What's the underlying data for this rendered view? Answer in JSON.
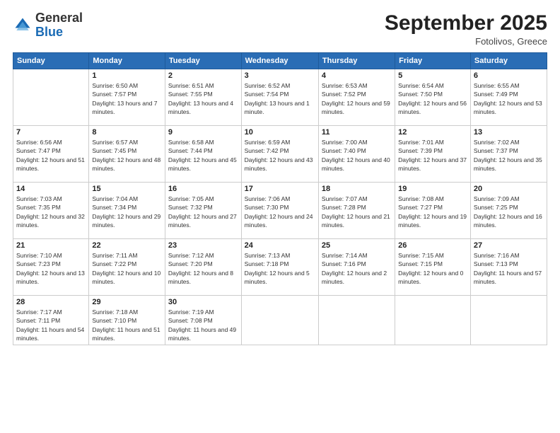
{
  "header": {
    "logo_general": "General",
    "logo_blue": "Blue",
    "month_title": "September 2025",
    "subtitle": "Fotolivos, Greece"
  },
  "days_of_week": [
    "Sunday",
    "Monday",
    "Tuesday",
    "Wednesday",
    "Thursday",
    "Friday",
    "Saturday"
  ],
  "weeks": [
    [
      {
        "day": "",
        "sunrise": "",
        "sunset": "",
        "daylight": ""
      },
      {
        "day": "1",
        "sunrise": "Sunrise: 6:50 AM",
        "sunset": "Sunset: 7:57 PM",
        "daylight": "Daylight: 13 hours and 7 minutes."
      },
      {
        "day": "2",
        "sunrise": "Sunrise: 6:51 AM",
        "sunset": "Sunset: 7:55 PM",
        "daylight": "Daylight: 13 hours and 4 minutes."
      },
      {
        "day": "3",
        "sunrise": "Sunrise: 6:52 AM",
        "sunset": "Sunset: 7:54 PM",
        "daylight": "Daylight: 13 hours and 1 minute."
      },
      {
        "day": "4",
        "sunrise": "Sunrise: 6:53 AM",
        "sunset": "Sunset: 7:52 PM",
        "daylight": "Daylight: 12 hours and 59 minutes."
      },
      {
        "day": "5",
        "sunrise": "Sunrise: 6:54 AM",
        "sunset": "Sunset: 7:50 PM",
        "daylight": "Daylight: 12 hours and 56 minutes."
      },
      {
        "day": "6",
        "sunrise": "Sunrise: 6:55 AM",
        "sunset": "Sunset: 7:49 PM",
        "daylight": "Daylight: 12 hours and 53 minutes."
      }
    ],
    [
      {
        "day": "7",
        "sunrise": "Sunrise: 6:56 AM",
        "sunset": "Sunset: 7:47 PM",
        "daylight": "Daylight: 12 hours and 51 minutes."
      },
      {
        "day": "8",
        "sunrise": "Sunrise: 6:57 AM",
        "sunset": "Sunset: 7:45 PM",
        "daylight": "Daylight: 12 hours and 48 minutes."
      },
      {
        "day": "9",
        "sunrise": "Sunrise: 6:58 AM",
        "sunset": "Sunset: 7:44 PM",
        "daylight": "Daylight: 12 hours and 45 minutes."
      },
      {
        "day": "10",
        "sunrise": "Sunrise: 6:59 AM",
        "sunset": "Sunset: 7:42 PM",
        "daylight": "Daylight: 12 hours and 43 minutes."
      },
      {
        "day": "11",
        "sunrise": "Sunrise: 7:00 AM",
        "sunset": "Sunset: 7:40 PM",
        "daylight": "Daylight: 12 hours and 40 minutes."
      },
      {
        "day": "12",
        "sunrise": "Sunrise: 7:01 AM",
        "sunset": "Sunset: 7:39 PM",
        "daylight": "Daylight: 12 hours and 37 minutes."
      },
      {
        "day": "13",
        "sunrise": "Sunrise: 7:02 AM",
        "sunset": "Sunset: 7:37 PM",
        "daylight": "Daylight: 12 hours and 35 minutes."
      }
    ],
    [
      {
        "day": "14",
        "sunrise": "Sunrise: 7:03 AM",
        "sunset": "Sunset: 7:35 PM",
        "daylight": "Daylight: 12 hours and 32 minutes."
      },
      {
        "day": "15",
        "sunrise": "Sunrise: 7:04 AM",
        "sunset": "Sunset: 7:34 PM",
        "daylight": "Daylight: 12 hours and 29 minutes."
      },
      {
        "day": "16",
        "sunrise": "Sunrise: 7:05 AM",
        "sunset": "Sunset: 7:32 PM",
        "daylight": "Daylight: 12 hours and 27 minutes."
      },
      {
        "day": "17",
        "sunrise": "Sunrise: 7:06 AM",
        "sunset": "Sunset: 7:30 PM",
        "daylight": "Daylight: 12 hours and 24 minutes."
      },
      {
        "day": "18",
        "sunrise": "Sunrise: 7:07 AM",
        "sunset": "Sunset: 7:28 PM",
        "daylight": "Daylight: 12 hours and 21 minutes."
      },
      {
        "day": "19",
        "sunrise": "Sunrise: 7:08 AM",
        "sunset": "Sunset: 7:27 PM",
        "daylight": "Daylight: 12 hours and 19 minutes."
      },
      {
        "day": "20",
        "sunrise": "Sunrise: 7:09 AM",
        "sunset": "Sunset: 7:25 PM",
        "daylight": "Daylight: 12 hours and 16 minutes."
      }
    ],
    [
      {
        "day": "21",
        "sunrise": "Sunrise: 7:10 AM",
        "sunset": "Sunset: 7:23 PM",
        "daylight": "Daylight: 12 hours and 13 minutes."
      },
      {
        "day": "22",
        "sunrise": "Sunrise: 7:11 AM",
        "sunset": "Sunset: 7:22 PM",
        "daylight": "Daylight: 12 hours and 10 minutes."
      },
      {
        "day": "23",
        "sunrise": "Sunrise: 7:12 AM",
        "sunset": "Sunset: 7:20 PM",
        "daylight": "Daylight: 12 hours and 8 minutes."
      },
      {
        "day": "24",
        "sunrise": "Sunrise: 7:13 AM",
        "sunset": "Sunset: 7:18 PM",
        "daylight": "Daylight: 12 hours and 5 minutes."
      },
      {
        "day": "25",
        "sunrise": "Sunrise: 7:14 AM",
        "sunset": "Sunset: 7:16 PM",
        "daylight": "Daylight: 12 hours and 2 minutes."
      },
      {
        "day": "26",
        "sunrise": "Sunrise: 7:15 AM",
        "sunset": "Sunset: 7:15 PM",
        "daylight": "Daylight: 12 hours and 0 minutes."
      },
      {
        "day": "27",
        "sunrise": "Sunrise: 7:16 AM",
        "sunset": "Sunset: 7:13 PM",
        "daylight": "Daylight: 11 hours and 57 minutes."
      }
    ],
    [
      {
        "day": "28",
        "sunrise": "Sunrise: 7:17 AM",
        "sunset": "Sunset: 7:11 PM",
        "daylight": "Daylight: 11 hours and 54 minutes."
      },
      {
        "day": "29",
        "sunrise": "Sunrise: 7:18 AM",
        "sunset": "Sunset: 7:10 PM",
        "daylight": "Daylight: 11 hours and 51 minutes."
      },
      {
        "day": "30",
        "sunrise": "Sunrise: 7:19 AM",
        "sunset": "Sunset: 7:08 PM",
        "daylight": "Daylight: 11 hours and 49 minutes."
      },
      {
        "day": "",
        "sunrise": "",
        "sunset": "",
        "daylight": ""
      },
      {
        "day": "",
        "sunrise": "",
        "sunset": "",
        "daylight": ""
      },
      {
        "day": "",
        "sunrise": "",
        "sunset": "",
        "daylight": ""
      },
      {
        "day": "",
        "sunrise": "",
        "sunset": "",
        "daylight": ""
      }
    ]
  ]
}
